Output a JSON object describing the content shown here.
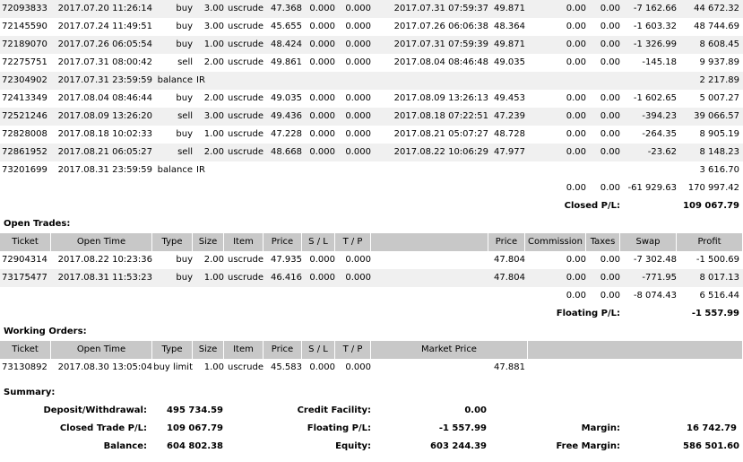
{
  "history_rows": [
    {
      "ticket": "72093833",
      "open_time": "2017.07.20 11:26:14",
      "type": "buy",
      "size": "3.00",
      "item": "uscrude",
      "price": "47.368",
      "sl": "0.000",
      "tp": "0.000",
      "close_time": "2017.07.31 07:59:37",
      "close_price": "49.871",
      "commission": "0.00",
      "taxes": "0.00",
      "swap": "-7 162.66",
      "profit": "44 672.32"
    },
    {
      "ticket": "72145590",
      "open_time": "2017.07.24 11:49:51",
      "type": "buy",
      "size": "3.00",
      "item": "uscrude",
      "price": "45.655",
      "sl": "0.000",
      "tp": "0.000",
      "close_time": "2017.07.26 06:06:38",
      "close_price": "48.364",
      "commission": "0.00",
      "taxes": "0.00",
      "swap": "-1 603.32",
      "profit": "48 744.69"
    },
    {
      "ticket": "72189070",
      "open_time": "2017.07.26 06:05:54",
      "type": "buy",
      "size": "1.00",
      "item": "uscrude",
      "price": "48.424",
      "sl": "0.000",
      "tp": "0.000",
      "close_time": "2017.07.31 07:59:39",
      "close_price": "49.871",
      "commission": "0.00",
      "taxes": "0.00",
      "swap": "-1 326.99",
      "profit": "8 608.45"
    },
    {
      "ticket": "72275751",
      "open_time": "2017.07.31 08:00:42",
      "type": "sell",
      "size": "2.00",
      "item": "uscrude",
      "price": "49.861",
      "sl": "0.000",
      "tp": "0.000",
      "close_time": "2017.08.04 08:46:48",
      "close_price": "49.035",
      "commission": "0.00",
      "taxes": "0.00",
      "swap": "-145.18",
      "profit": "9 937.89"
    },
    {
      "ticket": "72304902",
      "open_time": "2017.07.31 23:59:59",
      "balance": true,
      "type": "balance",
      "comment": "IR",
      "profit": "2 217.89"
    },
    {
      "ticket": "72413349",
      "open_time": "2017.08.04 08:46:44",
      "type": "buy",
      "size": "2.00",
      "item": "uscrude",
      "price": "49.035",
      "sl": "0.000",
      "tp": "0.000",
      "close_time": "2017.08.09 13:26:13",
      "close_price": "49.453",
      "commission": "0.00",
      "taxes": "0.00",
      "swap": "-1 602.65",
      "profit": "5 007.27"
    },
    {
      "ticket": "72521246",
      "open_time": "2017.08.09 13:26:20",
      "type": "sell",
      "size": "3.00",
      "item": "uscrude",
      "price": "49.436",
      "sl": "0.000",
      "tp": "0.000",
      "close_time": "2017.08.18 07:22:51",
      "close_price": "47.239",
      "commission": "0.00",
      "taxes": "0.00",
      "swap": "-394.23",
      "profit": "39 066.57"
    },
    {
      "ticket": "72828008",
      "open_time": "2017.08.18 10:02:33",
      "type": "buy",
      "size": "1.00",
      "item": "uscrude",
      "price": "47.228",
      "sl": "0.000",
      "tp": "0.000",
      "close_time": "2017.08.21 05:07:27",
      "close_price": "48.728",
      "commission": "0.00",
      "taxes": "0.00",
      "swap": "-264.35",
      "profit": "8 905.19"
    },
    {
      "ticket": "72861952",
      "open_time": "2017.08.21 06:05:27",
      "type": "sell",
      "size": "2.00",
      "item": "uscrude",
      "price": "48.668",
      "sl": "0.000",
      "tp": "0.000",
      "close_time": "2017.08.22 10:06:29",
      "close_price": "47.977",
      "commission": "0.00",
      "taxes": "0.00",
      "swap": "-23.62",
      "profit": "8 148.23"
    },
    {
      "ticket": "73201699",
      "open_time": "2017.08.31 23:59:59",
      "balance": true,
      "type": "balance",
      "comment": "IR",
      "profit": "3 616.70"
    }
  ],
  "history_totals": {
    "commission": "0.00",
    "taxes": "0.00",
    "swap": "-61 929.63",
    "profit": "170 997.42"
  },
  "closed_pl": {
    "label": "Closed P/L:",
    "value": "109 067.79"
  },
  "open_trades": {
    "title": "Open Trades:",
    "headers": {
      "ticket": "Ticket",
      "open_time": "Open Time",
      "type": "Type",
      "size": "Size",
      "item": "Item",
      "price": "Price",
      "sl": "S / L",
      "tp": "T / P",
      "cur_price": "Price",
      "commission": "Commission",
      "taxes": "Taxes",
      "swap": "Swap",
      "profit": "Profit"
    },
    "rows": [
      {
        "ticket": "72904314",
        "open_time": "2017.08.22 10:23:36",
        "type": "buy",
        "size": "2.00",
        "item": "uscrude",
        "price": "47.935",
        "sl": "0.000",
        "tp": "0.000",
        "cur_price": "47.804",
        "commission": "0.00",
        "taxes": "0.00",
        "swap": "-7 302.48",
        "profit": "-1 500.69"
      },
      {
        "ticket": "73175477",
        "open_time": "2017.08.31 11:53:23",
        "type": "buy",
        "size": "1.00",
        "item": "uscrude",
        "price": "46.416",
        "sl": "0.000",
        "tp": "0.000",
        "cur_price": "47.804",
        "commission": "0.00",
        "taxes": "0.00",
        "swap": "-771.95",
        "profit": "8 017.13"
      }
    ],
    "totals": {
      "commission": "0.00",
      "taxes": "0.00",
      "swap": "-8 074.43",
      "profit": "6 516.44"
    },
    "floating_label": "Floating P/L:",
    "floating_value": "-1 557.99"
  },
  "working_orders": {
    "title": "Working Orders:",
    "headers": {
      "ticket": "Ticket",
      "open_time": "Open Time",
      "type": "Type",
      "size": "Size",
      "item": "Item",
      "price": "Price",
      "sl": "S / L",
      "tp": "T / P",
      "market_price": "Market Price"
    },
    "rows": [
      {
        "ticket": "73130892",
        "open_time": "2017.08.30 13:05:04",
        "type": "buy limit",
        "size": "1.00",
        "item": "uscrude",
        "price": "45.583",
        "sl": "0.000",
        "tp": "0.000",
        "market_price": "47.881"
      }
    ]
  },
  "summary": {
    "title": "Summary:",
    "deposit_label": "Deposit/Withdrawal:",
    "deposit_value": "495 734.59",
    "credit_label": "Credit Facility:",
    "credit_value": "0.00",
    "closed_label": "Closed Trade P/L:",
    "closed_value": "109 067.79",
    "floating_label": "Floating P/L:",
    "floating_value": "-1 557.99",
    "margin_label": "Margin:",
    "margin_value": "16 742.79",
    "balance_label": "Balance:",
    "balance_value": "604 802.38",
    "equity_label": "Equity:",
    "equity_value": "603 244.39",
    "free_margin_label": "Free Margin:",
    "free_margin_value": "586 501.60"
  },
  "colors": {
    "header_bg": "#c8c8c8",
    "alt_row_bg": "#f0f0f0"
  }
}
